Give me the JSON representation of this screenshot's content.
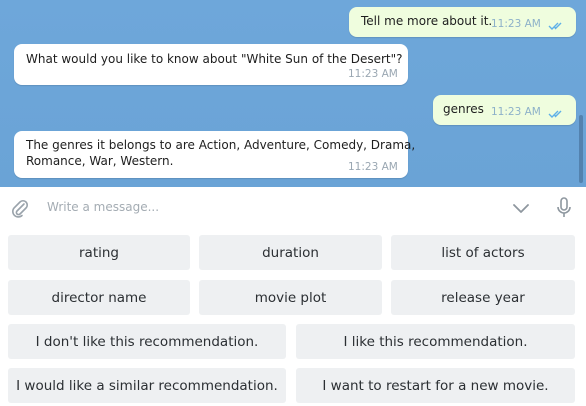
{
  "messages": [
    {
      "text": "Tell me more about it.",
      "time": "11:23 AM",
      "outgoing": true
    },
    {
      "text": "What would you like to know about \"White Sun of the Desert\"?",
      "time": "11:23 AM",
      "outgoing": false
    },
    {
      "text": "genres",
      "time": "11:23 AM",
      "outgoing": true
    },
    {
      "text_line1": "The genres it belongs to are Action, Adventure, Comedy, Drama,",
      "text_line2": "Romance, War, Western.",
      "time": "11:23 AM",
      "outgoing": false
    }
  ],
  "composer": {
    "placeholder": "Write a message...",
    "icons": [
      "paperclip-icon",
      "chevron-down-icon",
      "microphone-icon"
    ]
  },
  "keyboard": {
    "row1": [
      "rating",
      "duration",
      "list of actors"
    ],
    "row2": [
      "director name",
      "movie plot",
      "release year"
    ],
    "row3": [
      "I don't like this recommendation.",
      "I like this recommendation."
    ],
    "row4": [
      "I would like a similar recommendation.",
      "I want to restart for a new movie."
    ]
  },
  "colors": {
    "chat_background": "#6fa8dc",
    "outgoing_bubble": "#effdde",
    "incoming_bubble": "#ffffff",
    "keyboard_button": "#eef0f2",
    "read_check": "#5fb0e8"
  }
}
